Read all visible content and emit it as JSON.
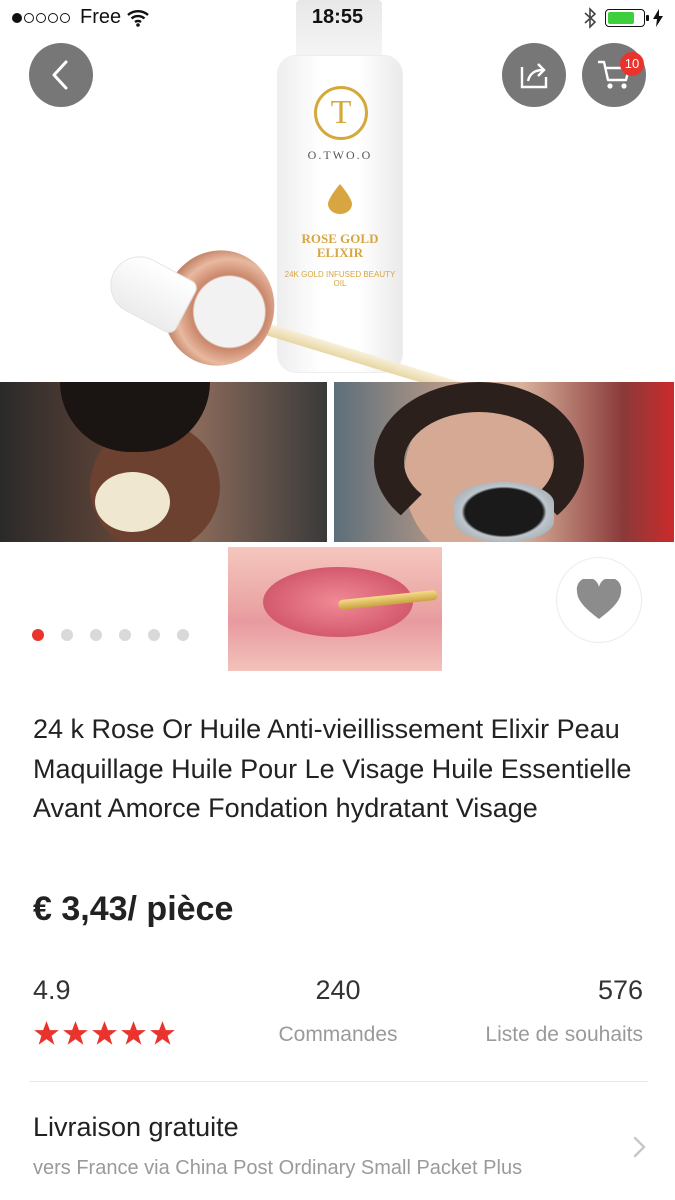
{
  "status_bar": {
    "carrier": "Free",
    "time": "18:55",
    "battery_level": 0.75
  },
  "header": {
    "back_icon": "chevron-left-icon",
    "share_icon": "share-icon",
    "cart_icon": "cart-icon",
    "cart_count": "10"
  },
  "gallery": {
    "bottle_brand": "O.TWO.O",
    "bottle_logo": "T",
    "bottle_label_main": "ROSE GOLD ELIXIR",
    "bottle_label_sub": "24K GOLD INFUSED BEAUTY OIL",
    "page_count": 6,
    "active_page": 1
  },
  "product": {
    "title": "24 k Rose Or Huile Anti-vieillissement Elixir Peau Maquillage Huile Pour Le Visage Huile Essentielle Avant Amorce Fondation hydratant Visage",
    "price": "€ 3,43/ pièce"
  },
  "stats": {
    "rating": "4.9",
    "stars": 5,
    "orders": "240",
    "orders_label": "Commandes",
    "wishlist": "576",
    "wishlist_label": "Liste de souhaits"
  },
  "shipping": {
    "title": "Livraison gratuite",
    "subtitle": "vers France via China Post Ordinary Small Packet Plus"
  },
  "colors": {
    "accent": "#e8342c",
    "gold": "#d4a93a"
  }
}
